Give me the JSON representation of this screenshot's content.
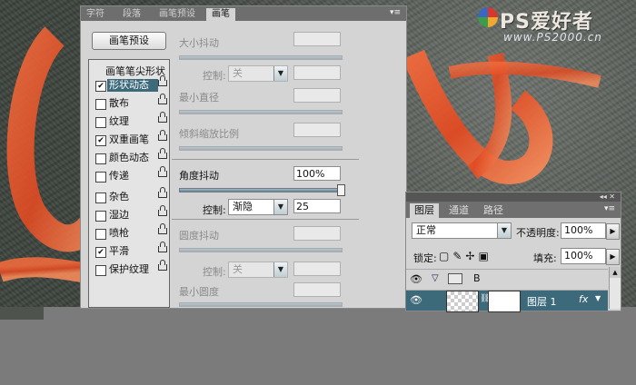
{
  "brush_panel": {
    "tabs": [
      "字符",
      "段落",
      "画笔预设",
      "画笔"
    ],
    "active_tab": "画笔",
    "preset_button": "画笔预设",
    "list_header": "画笔笔尖形状",
    "options": [
      {
        "label": "形状动态",
        "checked": true
      },
      {
        "label": "散布",
        "checked": false
      },
      {
        "label": "纹理",
        "checked": false
      },
      {
        "label": "双重画笔",
        "checked": true
      },
      {
        "label": "颜色动态",
        "checked": false
      },
      {
        "label": "传递",
        "checked": false
      },
      {
        "label": "杂色",
        "checked": false
      },
      {
        "label": "湿边",
        "checked": false
      },
      {
        "label": "喷枪",
        "checked": false
      },
      {
        "label": "平滑",
        "checked": true
      },
      {
        "label": "保护纹理",
        "checked": false
      }
    ],
    "size_jitter_label": "大小抖动",
    "control_label": "控制:",
    "control_off": "关",
    "min_diameter_label": "最小直径",
    "tilt_scale_label": "倾斜缩放比例",
    "angle_jitter_label": "角度抖动",
    "angle_jitter_value": "100%",
    "angle_control_value": "渐隐",
    "angle_control_steps": "25",
    "roundness_jitter_label": "圆度抖动",
    "min_roundness_label": "最小圆度"
  },
  "layers_panel": {
    "tabs": [
      "图层",
      "通道",
      "路径"
    ],
    "blend_mode": "正常",
    "opacity_label": "不透明度:",
    "opacity_value": "100%",
    "lock_label": "锁定:",
    "fill_label": "填充:",
    "fill_value": "100%",
    "group_name": "B",
    "layer_name": "图层 1",
    "fx_label": "fx"
  },
  "watermark": {
    "text": "PS爱好者",
    "url": "www.PS2000.cn"
  }
}
